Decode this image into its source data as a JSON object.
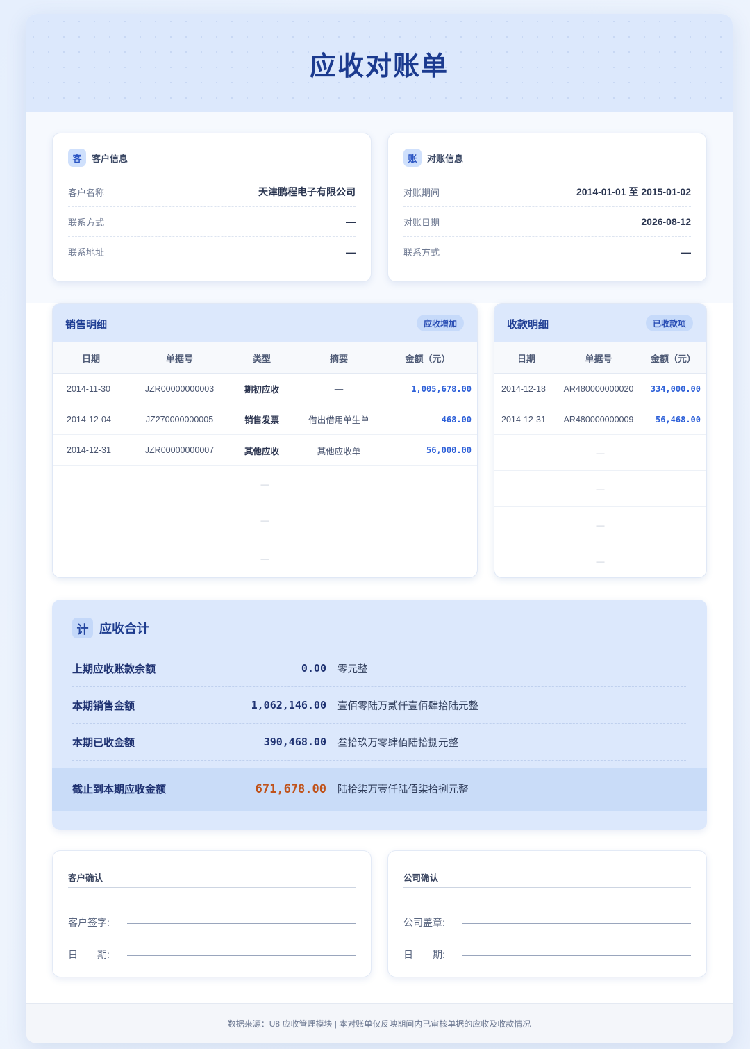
{
  "title": "应收对账单",
  "customer_card": {
    "badge": "客",
    "label": "客户信息",
    "fields": [
      {
        "label": "客户名称",
        "value": "天津鹏程电子有限公司"
      },
      {
        "label": "联系方式",
        "value": "—"
      },
      {
        "label": "联系地址",
        "value": "—"
      }
    ]
  },
  "reconcile_card": {
    "badge": "账",
    "label": "对账信息",
    "fields": [
      {
        "label": "对账期间",
        "value": "2014-01-01 至 2015-01-02"
      },
      {
        "label": "对账日期",
        "value": "2026-08-12"
      },
      {
        "label": "联系方式",
        "value": "—"
      }
    ]
  },
  "sales": {
    "title": "销售明细",
    "tag": "应收增加",
    "columns": [
      "日期",
      "单据号",
      "类型",
      "摘要",
      "金额（元）"
    ],
    "rows": [
      {
        "date": "2014-11-30",
        "doc": "JZR00000000003",
        "type": "期初应收",
        "memo": "—",
        "amount": "1,005,678.00"
      },
      {
        "date": "2014-12-04",
        "doc": "JZ270000000005",
        "type": "销售发票",
        "memo": "借出借用单生单",
        "amount": "468.00"
      },
      {
        "date": "2014-12-31",
        "doc": "JZR00000000007",
        "type": "其他应收",
        "memo": "其他应收单",
        "amount": "56,000.00"
      }
    ],
    "empty_rows": [
      "—",
      "—",
      "—"
    ]
  },
  "receipts": {
    "title": "收款明细",
    "tag": "已收款项",
    "columns": [
      "日期",
      "单据号",
      "金额（元）"
    ],
    "rows": [
      {
        "date": "2014-12-18",
        "doc": "AR480000000020",
        "amount": "334,000.00"
      },
      {
        "date": "2014-12-31",
        "doc": "AR480000000009",
        "amount": "56,468.00"
      }
    ],
    "empty_rows": [
      "—",
      "—",
      "—",
      "—"
    ]
  },
  "summary": {
    "badge": "计",
    "title": "应收合计",
    "rows": [
      {
        "label": "上期应收账款余额",
        "amount": "0.00",
        "words": "零元整"
      },
      {
        "label": "本期销售金额",
        "amount": "1,062,146.00",
        "words": "壹佰零陆万贰仟壹佰肆拾陆元整"
      },
      {
        "label": "本期已收金额",
        "amount": "390,468.00",
        "words": "叁拾玖万零肆佰陆拾捌元整"
      }
    ],
    "final": {
      "label": "截止到本期应收金额",
      "amount": "671,678.00",
      "words": "陆拾柒万壹仟陆佰柒拾捌元整"
    }
  },
  "customer_confirm": {
    "title": "客户确认",
    "sign_label": "客户签字:",
    "date_label": "日　　期:"
  },
  "company_confirm": {
    "title": "公司确认",
    "sign_label": "公司盖章:",
    "date_label": "日　　期:"
  },
  "footer": "数据来源：U8 应收管理模块 | 本对账单仅反映期间内已审核单据的应收及收款情况"
}
